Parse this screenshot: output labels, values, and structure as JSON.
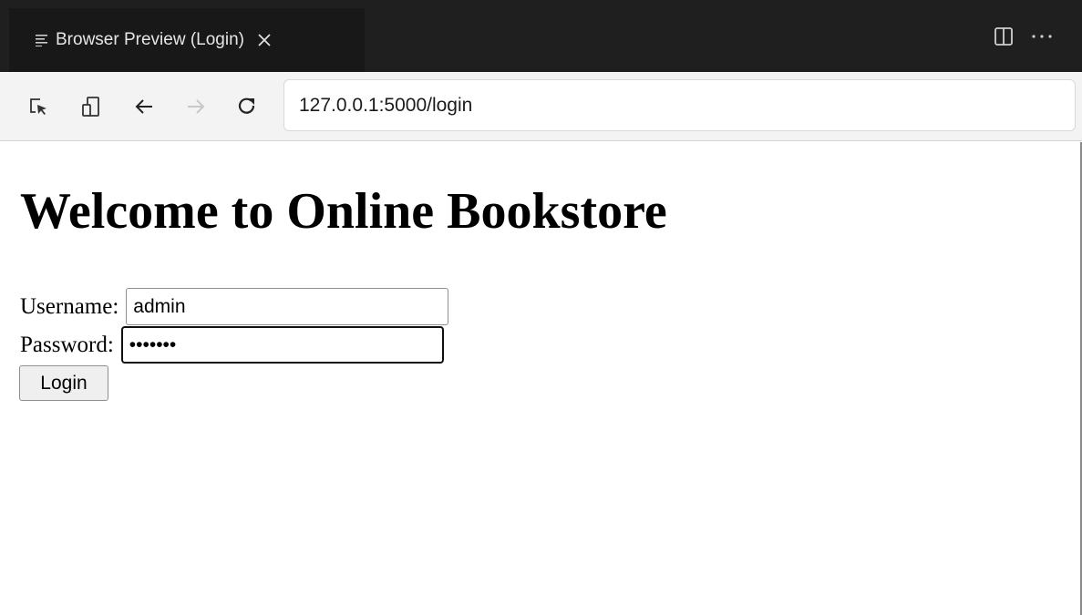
{
  "tab": {
    "title": "Browser Preview (Login)",
    "icons": {
      "doc": "document-lines-icon",
      "close": "close-icon"
    }
  },
  "tab_actions": {
    "split": "split-editor-icon",
    "more": "more-actions-icon"
  },
  "toolbar": {
    "icons": [
      "inspect-element-icon",
      "device-toggle-icon",
      "back-arrow-icon",
      "forward-arrow-icon",
      "reload-icon"
    ],
    "url": "127.0.0.1:5000/login"
  },
  "page": {
    "heading": "Welcome to Online Bookstore",
    "username_label": "Username:",
    "username_value": "admin",
    "password_label": "Password:",
    "password_value": "•••••••",
    "login_label": "Login"
  },
  "colors": {
    "tabbar_bg": "#1f1f1f",
    "active_tab_bg": "#181818",
    "toolbar_bg": "#f3f3f3",
    "page_bg": "#ffffff"
  }
}
